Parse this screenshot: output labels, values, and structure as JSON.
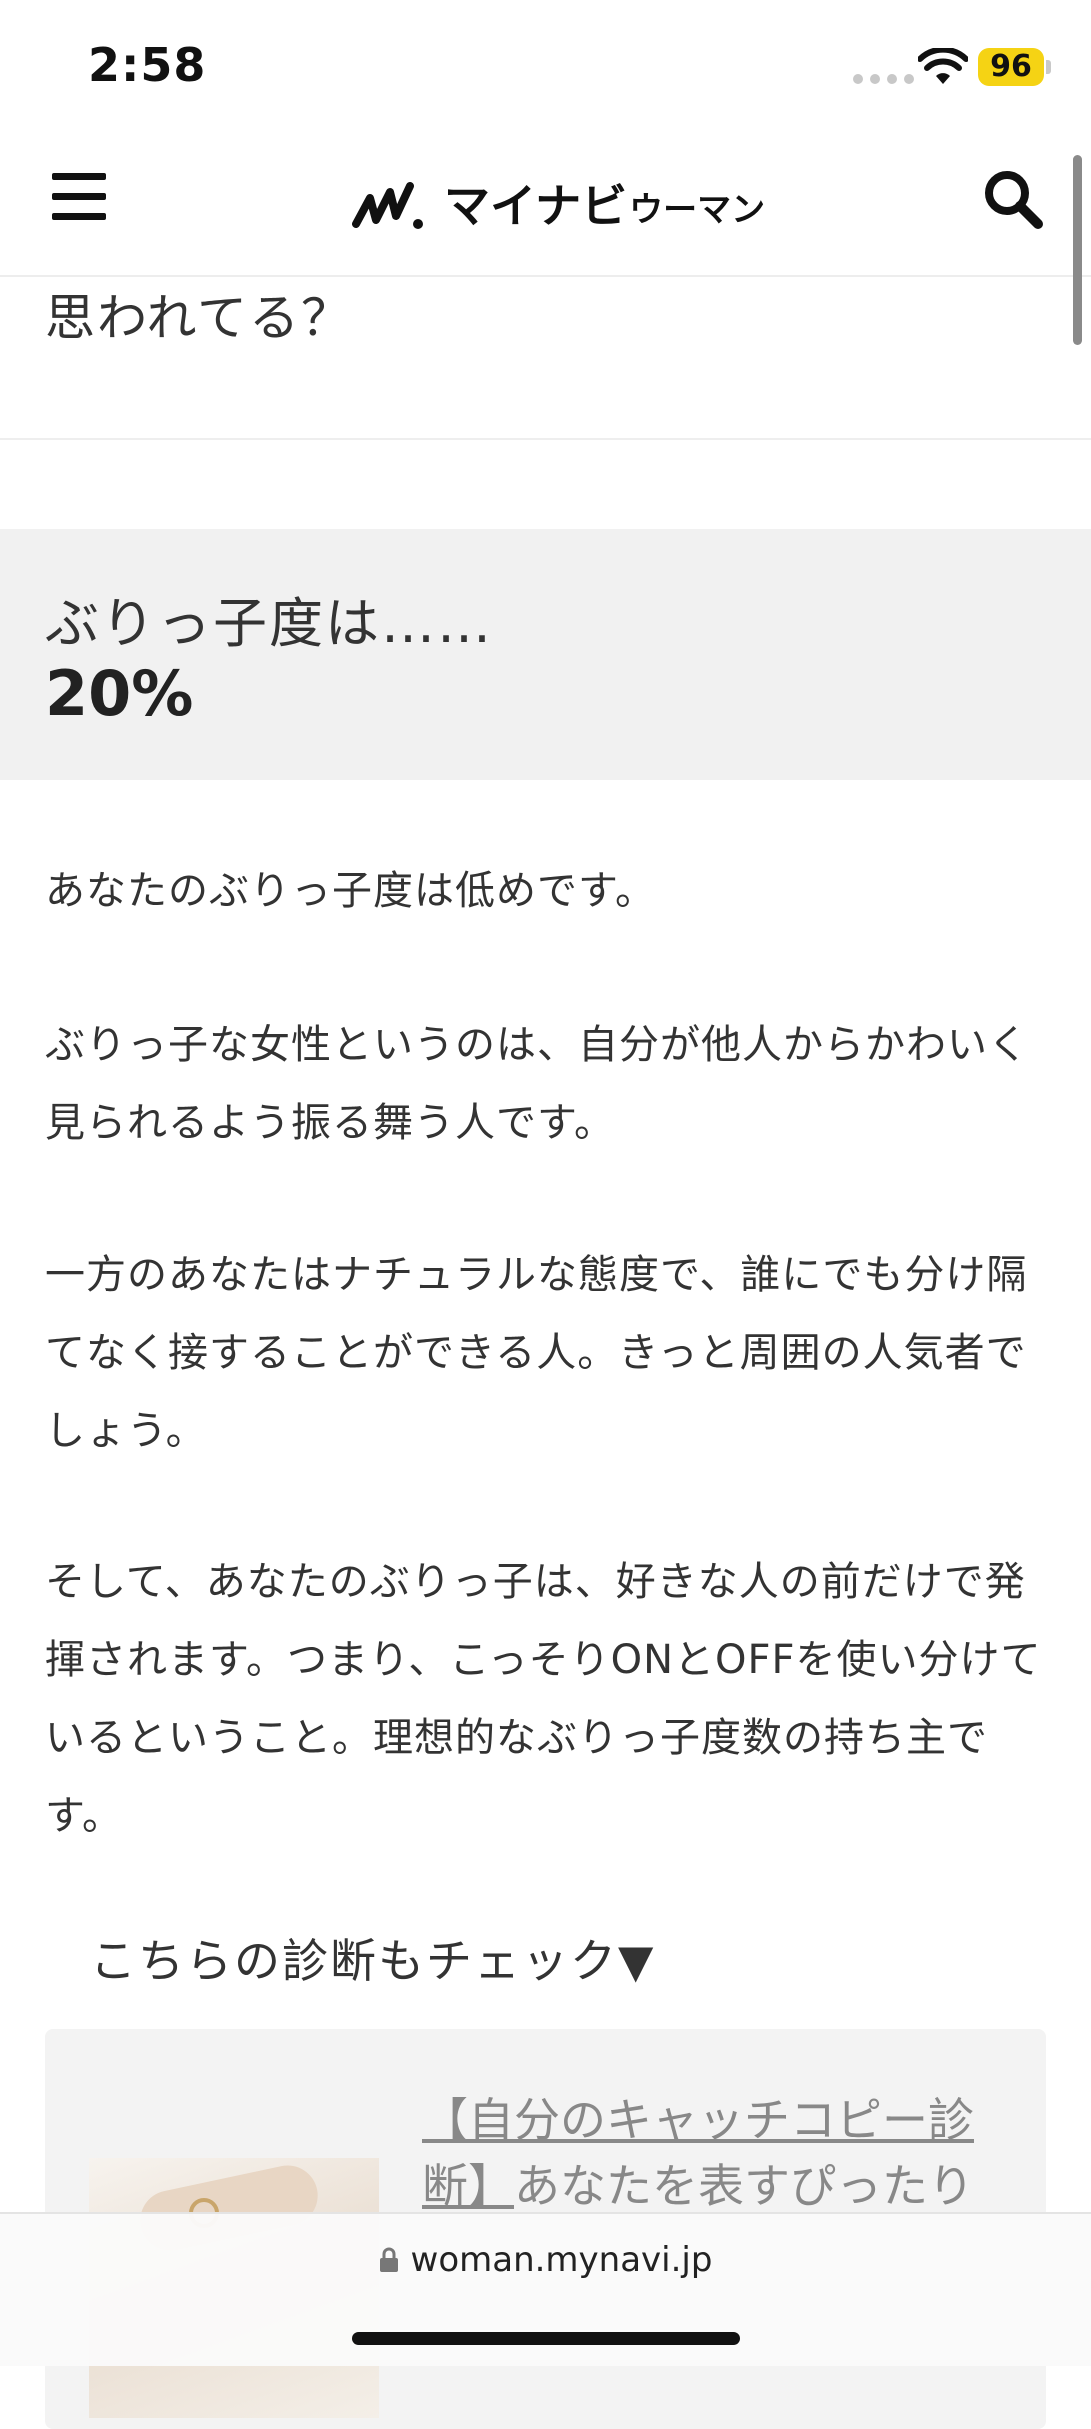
{
  "status_bar": {
    "time": "2:58",
    "battery": "96",
    "battery_color": "#f5d314"
  },
  "header": {
    "logo_main": "マイナビ",
    "logo_sub": "ウーマン",
    "menu_icon": "hamburger-menu-icon",
    "search_icon": "search-icon"
  },
  "content": {
    "question_tail": "思われてる？",
    "result_label": "ぶりっ子度は……",
    "result_value": "20%",
    "paragraphs": [
      "あなたのぶりっ子度は低めです。",
      "ぶりっ子な女性というのは、自分が他人からかわいく見られるよう振る舞う人です。",
      "一方のあなたはナチュラルな態度で、誰にでも分け隔てなく接することができる人。きっと周囲の人気者でしょう。",
      "そして、あなたのぶりっ子は、好きな人の前だけで発揮されます。つまり、こっそりONとOFFを使い分けているということ。理想的なぶりっ子度数の持ち主です。"
    ],
    "check_heading": "こちらの診断もチェック▼",
    "related": {
      "title_link": "【自分のキャッチコピー診断】",
      "title_rest": "あなたを表すぴったり"
    }
  },
  "browser": {
    "url": "woman.mynavi.jp",
    "lock_icon": "lock-icon"
  }
}
